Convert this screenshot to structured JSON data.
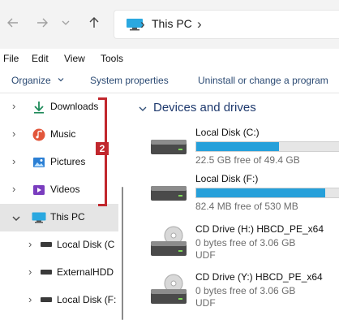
{
  "address_bar": {
    "back_icon": "arrow-left-icon",
    "forward_icon": "arrow-right-icon",
    "recent_icon": "chevron-down-icon",
    "up_icon": "arrow-up-icon",
    "location_icon": "monitor-icon",
    "separator": "›",
    "crumb": "This PC"
  },
  "menu": [
    "File",
    "Edit",
    "View",
    "Tools"
  ],
  "toolbar": {
    "organize": "Organize",
    "system_properties": "System properties",
    "uninstall": "Uninstall or change a program"
  },
  "nav": {
    "items": [
      {
        "label": "Downloads",
        "icon": "download-icon",
        "color": "#1e8a5a"
      },
      {
        "label": "Music",
        "icon": "music-icon",
        "color": "#e2563b"
      },
      {
        "label": "Pictures",
        "icon": "pictures-icon",
        "color": "#2b7fd4"
      },
      {
        "label": "Videos",
        "icon": "videos-icon",
        "color": "#7a3dbf"
      },
      {
        "label": "This PC",
        "icon": "monitor-icon",
        "selected": true
      },
      {
        "label": "Local Disk (C",
        "icon": "drive-icon"
      },
      {
        "label": "ExternalHDD",
        "icon": "drive-icon"
      },
      {
        "label": "Local Disk (F:",
        "icon": "drive-icon"
      }
    ],
    "annotation_number": "2",
    "annotation_color": "#c1272d"
  },
  "main": {
    "section_title": "Devices and drives",
    "drives": [
      {
        "name": "Local Disk (C:)",
        "free_text": "22.5 GB free of 49.4 GB",
        "used_fraction": 0.545,
        "type": "hdd"
      },
      {
        "name": "Local Disk (F:)",
        "free_text": "82.4 MB free of 530 MB",
        "used_fraction": 0.845,
        "type": "hdd"
      },
      {
        "name": "CD Drive (H:) HBCD_PE_x64",
        "free_text": "0 bytes free of 3.06 GB",
        "fs": "UDF",
        "type": "cd"
      },
      {
        "name": "CD Drive (Y:) HBCD_PE_x64",
        "free_text": "0 bytes free of 3.06 GB",
        "fs": "UDF",
        "type": "cd"
      }
    ],
    "accent_color": "#26a0da"
  }
}
